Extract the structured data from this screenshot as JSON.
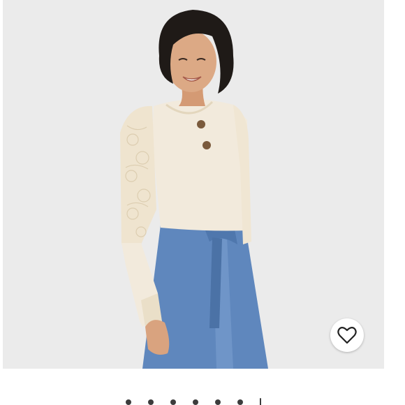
{
  "listing": {
    "image_alt": "",
    "favorite_icon": "heart-outline-icon",
    "carousel": {
      "total_indicators": 7,
      "active_index": 0
    }
  },
  "colors": {
    "background": "#ebebeb",
    "top": "#f2eadc",
    "denim": "#5f87bd",
    "hair": "#1f1a17",
    "icon": "#222222"
  }
}
